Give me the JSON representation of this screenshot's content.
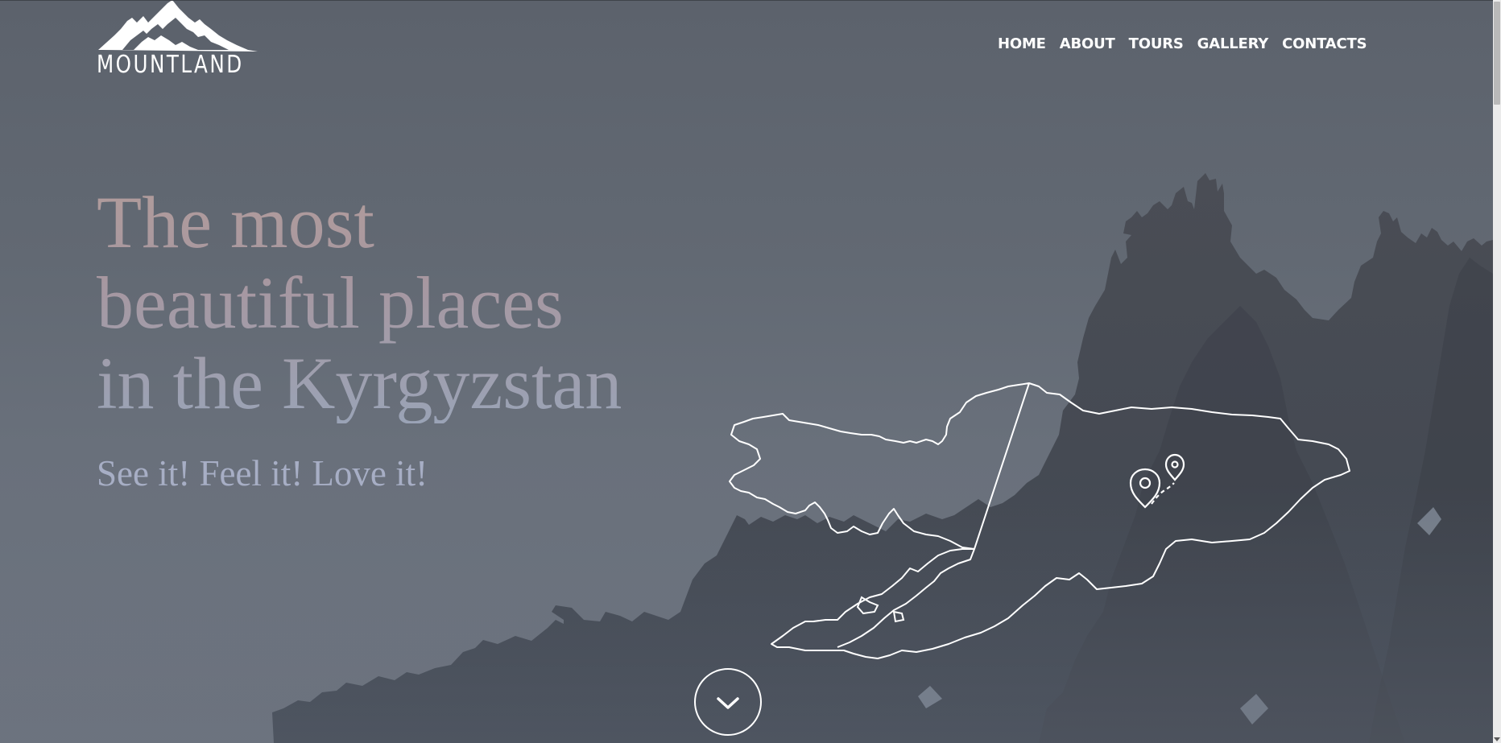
{
  "brand": {
    "name": "MOUNTLAND"
  },
  "nav": {
    "items": [
      {
        "label": "HOME"
      },
      {
        "label": "ABOUT"
      },
      {
        "label": "TOURS"
      },
      {
        "label": "GALLERY"
      },
      {
        "label": "CONTACTS"
      }
    ]
  },
  "hero": {
    "headline": [
      "The most",
      "beautiful places",
      "in the Kyrgyzstan"
    ],
    "tagline": "See it! Feel it! Love it!",
    "scroll_icon": "chevron-down-icon",
    "map_icon": "map-pin-route-icon"
  },
  "colors": {
    "background": "#626973",
    "mountains": "#4b4f58",
    "headline_top": "#b19c9b",
    "headline_bottom": "#9aa3b6",
    "tagline": "#a7aec5",
    "nav_text": "#ffffff"
  }
}
